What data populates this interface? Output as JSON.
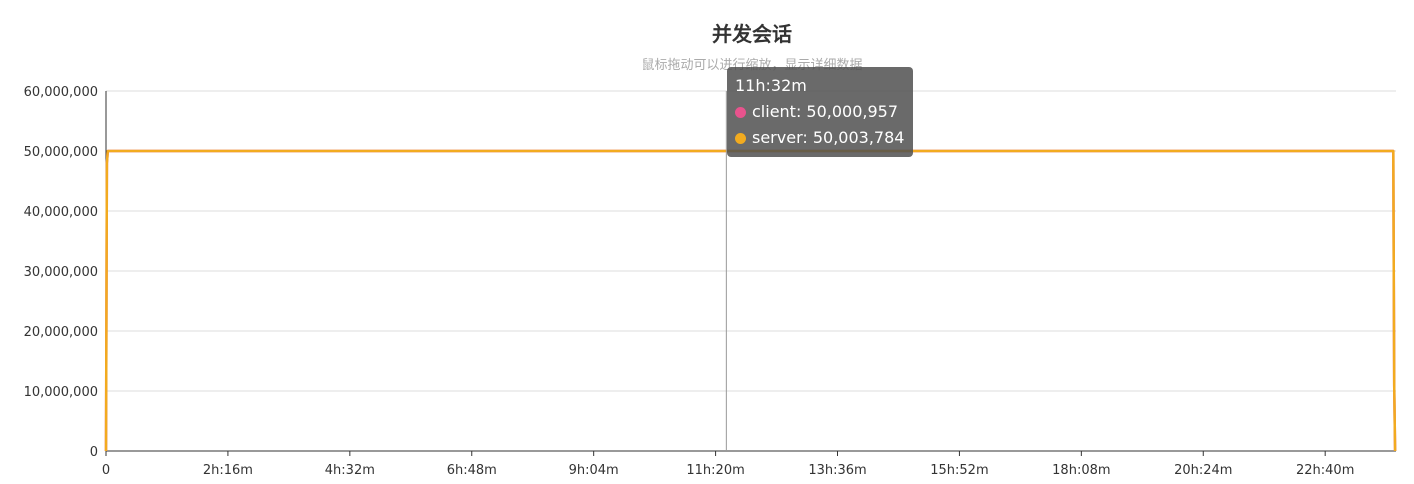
{
  "chart_data": {
    "type": "line",
    "title": "并发会话",
    "subtitle": "鼠标拖动可以进行缩放，显示详细数据",
    "xlabel": "",
    "ylabel": "",
    "x_ticks_minutes": [
      0,
      136,
      272,
      408,
      544,
      680,
      816,
      952,
      1088,
      1224,
      1360
    ],
    "x_tick_labels": [
      "0",
      "2h:16m",
      "4h:32m",
      "6h:48m",
      "9h:04m",
      "11h:20m",
      "13h:36m",
      "15h:52m",
      "18h:08m",
      "20h:24m",
      "22h:40m"
    ],
    "y_ticks": [
      0,
      10000000,
      20000000,
      30000000,
      40000000,
      50000000,
      60000000
    ],
    "y_tick_labels": [
      "0",
      "10,000,000",
      "20,000,000",
      "30,000,000",
      "40,000,000",
      "50,000,000",
      "60,000,000"
    ],
    "ylim": [
      0,
      60000000
    ],
    "xlim_minutes": [
      0,
      1439
    ],
    "grid": true,
    "series": [
      {
        "name": "client",
        "color": "#e8538d",
        "x_minutes": [
          0,
          1,
          2,
          692,
          1436,
          1437,
          1438
        ],
        "values": [
          0,
          48000000,
          50000000,
          50000957,
          50000000,
          11000000,
          0
        ]
      },
      {
        "name": "server",
        "color": "#f2ab1f",
        "x_minutes": [
          0,
          1,
          2,
          692,
          1436,
          1437,
          1438
        ],
        "values": [
          0,
          48000000,
          50000000,
          50003784,
          50000000,
          11000000,
          0
        ]
      }
    ],
    "tooltip": {
      "x_label": "11h:32m",
      "x_minutes": 692,
      "rows": [
        {
          "name": "client",
          "text": "client: 50,000,957",
          "color": "#e8538d"
        },
        {
          "name": "server",
          "text": "server: 50,003,784",
          "color": "#f2ab1f"
        }
      ]
    }
  }
}
